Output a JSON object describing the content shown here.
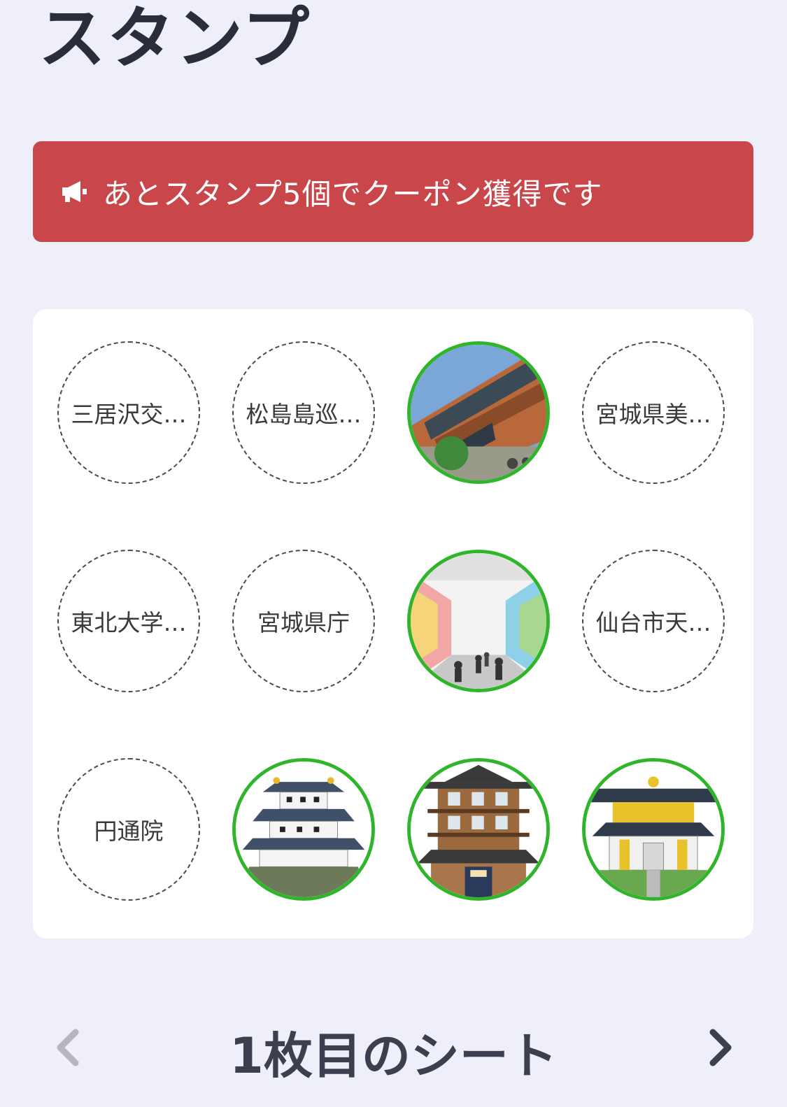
{
  "page": {
    "title": "スタンプ"
  },
  "banner": {
    "icon": "megaphone-icon",
    "text": "あとスタンプ5個でクーポン獲得です",
    "color": "#c9474a"
  },
  "stamps": [
    {
      "label": "三居沢交…",
      "collected": false
    },
    {
      "label": "松島島巡…",
      "collected": false
    },
    {
      "label": "",
      "collected": true,
      "image": "station-building-photo"
    },
    {
      "label": "宮城県美…",
      "collected": false
    },
    {
      "label": "東北大学…",
      "collected": false
    },
    {
      "label": "宮城県庁",
      "collected": false
    },
    {
      "label": "",
      "collected": true,
      "image": "shopping-arcade-illustration"
    },
    {
      "label": "仙台市天…",
      "collected": false
    },
    {
      "label": "円通院",
      "collected": false
    },
    {
      "label": "",
      "collected": true,
      "image": "castle-illustration"
    },
    {
      "label": "",
      "collected": true,
      "image": "ryokan-illustration"
    },
    {
      "label": "",
      "collected": true,
      "image": "shrine-gate-illustration"
    }
  ],
  "pager": {
    "label": "1枚目のシート",
    "prev_icon": "chevron-left-icon",
    "next_icon": "chevron-right-icon"
  },
  "colors": {
    "background": "#eeeff9",
    "collected_ring": "#2fb52a",
    "banner": "#c9474a"
  }
}
